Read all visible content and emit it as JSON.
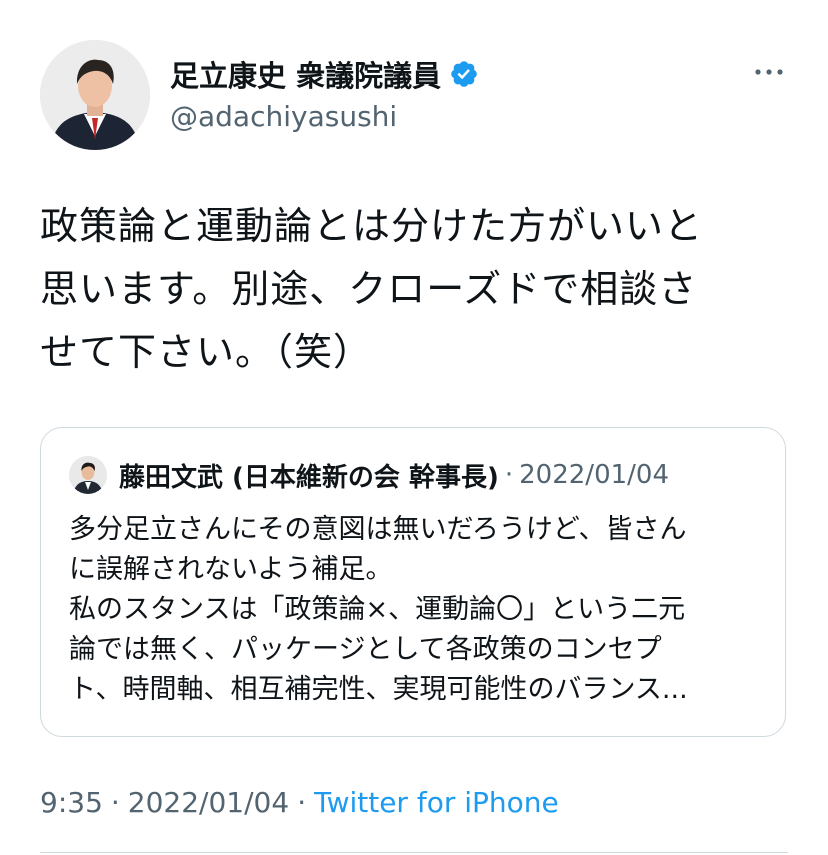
{
  "author": {
    "display_name": "足立康史 衆議院議員",
    "handle": "@adachiyasushi",
    "verified": true,
    "avatar_icon": "person-portrait-icon"
  },
  "tweet": {
    "text": "政策論と運動論とは分けた方がいいと\n思います。別途、クローズドで相談さ\nせて下さい。（笑）"
  },
  "quoted_tweet": {
    "author_name": "藤田文武 (日本維新の会 幹事長)",
    "separator": "·",
    "date": "2022/01/04",
    "text": "多分足立さんにその意図は無いだろうけど、皆さん\nに誤解されないよう補足。\n私のスタンスは「政策論×、運動論〇」という二元\n論では無く、パッケージとして各政策のコンセプ\nト、時間軸、相互補完性、実現可能性のバランス..."
  },
  "meta": {
    "time": "9:35",
    "separator1": "·",
    "date": "2022/01/04",
    "separator2": "·",
    "source": "Twitter for iPhone"
  },
  "colors": {
    "verified_blue": "#1d9bf0",
    "secondary_text": "#536471",
    "border": "#cfd9de",
    "link": "#1d9bf0"
  }
}
